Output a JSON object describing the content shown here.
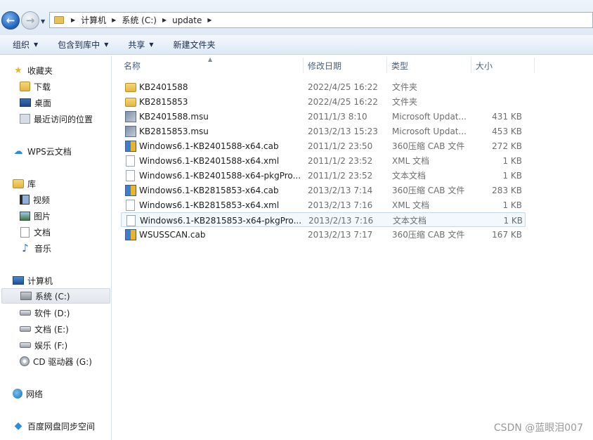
{
  "address": {
    "crumbs": [
      "计算机",
      "系统 (C:)",
      "update"
    ]
  },
  "toolbar": {
    "organize": "组织",
    "include_in_library": "包含到库中",
    "share": "共享",
    "new_folder": "新建文件夹"
  },
  "nav": {
    "favorites": "收藏夹",
    "downloads": "下载",
    "desktop": "桌面",
    "recent": "最近访问的位置",
    "wps_cloud": "WPS云文档",
    "libraries": "库",
    "videos": "视频",
    "pictures": "图片",
    "documents": "文档",
    "music": "音乐",
    "computer": "计算机",
    "drive_c": "系统 (C:)",
    "drive_d": "软件 (D:)",
    "drive_e": "文档 (E:)",
    "drive_f": "娱乐 (F:)",
    "drive_g": "CD 驱动器 (G:)",
    "network": "网络",
    "baidu": "百度网盘同步空间"
  },
  "columns": {
    "name": "名称",
    "date": "修改日期",
    "type": "类型",
    "size": "大小"
  },
  "files": [
    {
      "name": "KB2401588",
      "date": "2022/4/25 16:22",
      "type": "文件夹",
      "size": "",
      "icon": "folder"
    },
    {
      "name": "KB2815853",
      "date": "2022/4/25 16:22",
      "type": "文件夹",
      "size": "",
      "icon": "folder"
    },
    {
      "name": "KB2401588.msu",
      "date": "2011/1/3 8:10",
      "type": "Microsoft Updat...",
      "size": "431 KB",
      "icon": "msu"
    },
    {
      "name": "KB2815853.msu",
      "date": "2013/2/13 15:23",
      "type": "Microsoft Updat...",
      "size": "453 KB",
      "icon": "msu"
    },
    {
      "name": "Windows6.1-KB2401588-x64.cab",
      "date": "2011/1/2 23:50",
      "type": "360压缩 CAB 文件",
      "size": "272 KB",
      "icon": "cab"
    },
    {
      "name": "Windows6.1-KB2401588-x64.xml",
      "date": "2011/1/2 23:52",
      "type": "XML 文档",
      "size": "1 KB",
      "icon": "doc"
    },
    {
      "name": "Windows6.1-KB2401588-x64-pkgPro...",
      "date": "2011/1/2 23:52",
      "type": "文本文档",
      "size": "1 KB",
      "icon": "doc"
    },
    {
      "name": "Windows6.1-KB2815853-x64.cab",
      "date": "2013/2/13 7:14",
      "type": "360压缩 CAB 文件",
      "size": "283 KB",
      "icon": "cab"
    },
    {
      "name": "Windows6.1-KB2815853-x64.xml",
      "date": "2013/2/13 7:16",
      "type": "XML 文档",
      "size": "1 KB",
      "icon": "doc"
    },
    {
      "name": "Windows6.1-KB2815853-x64-pkgPro...",
      "date": "2013/2/13 7:16",
      "type": "文本文档",
      "size": "1 KB",
      "icon": "doc"
    },
    {
      "name": "WSUSSCAN.cab",
      "date": "2013/2/13 7:17",
      "type": "360压缩 CAB 文件",
      "size": "167 KB",
      "icon": "cab"
    }
  ],
  "watermark": "CSDN @蓝眼泪007"
}
